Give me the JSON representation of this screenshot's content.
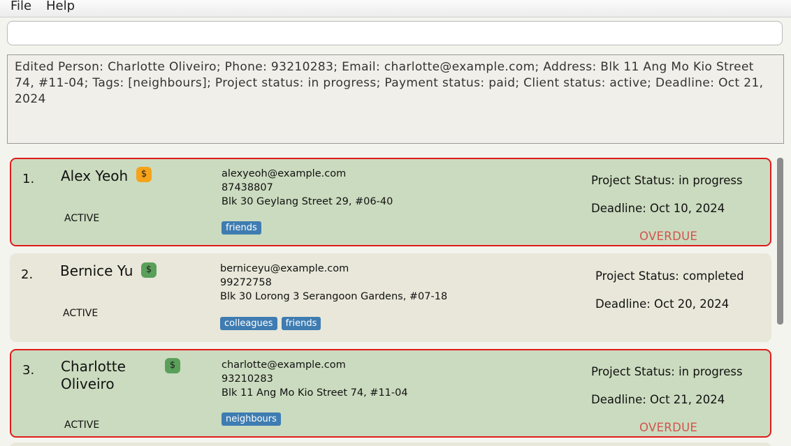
{
  "menu": [
    "File",
    "Help"
  ],
  "command_box": {
    "value": "",
    "placeholder": ""
  },
  "result": "Edited Person: Charlotte Oliveiro; Phone: 93210283; Email: charlotte@example.com; Address: Blk 11 Ang Mo Kio Street 74, #11-04; Tags: [neighbours]; Project status: in progress; Payment status: paid; Client status: active; Deadline: Oct 21, 2024",
  "colors": {
    "overdue_border": "#e01b1b",
    "overdue_card_bg": "#cbdbbf",
    "card_bg": "#e8e7d9",
    "tag_bg": "#3e7cb1",
    "pay_pending": "#f5a31a",
    "pay_paid": "#5aa05a",
    "overdue_text": "#d0544c"
  },
  "persons": [
    {
      "index": "1.",
      "name": "Alex Yeoh",
      "payment_icon": "dollar-icon",
      "payment_symbol": "$",
      "client_status": "ACTIVE",
      "email": "alexyeoh@example.com",
      "phone": "87438807",
      "address": "Blk 30 Geylang Street 29, #06-40",
      "tags": [
        "friends"
      ],
      "project_status": "Project Status: in progress",
      "deadline": "Deadline: Oct 10, 2024",
      "overdue": "OVERDUE"
    },
    {
      "index": "2.",
      "name": "Bernice Yu",
      "payment_icon": "dollar-icon",
      "payment_symbol": "$",
      "client_status": "ACTIVE",
      "email": "berniceyu@example.com",
      "phone": "99272758",
      "address": "Blk 30 Lorong 3 Serangoon Gardens, #07-18",
      "tags": [
        "colleagues",
        "friends"
      ],
      "project_status": "Project Status: completed",
      "deadline": "Deadline: Oct 20, 2024",
      "overdue": ""
    },
    {
      "index": "3.",
      "name": "Charlotte Oliveiro",
      "name_lines": [
        "Charlotte",
        "Oliveiro"
      ],
      "payment_icon": "dollar-icon",
      "payment_symbol": "$",
      "client_status": "ACTIVE",
      "email": "charlotte@example.com",
      "phone": "93210283",
      "address": "Blk 11 Ang Mo Kio Street 74, #11-04",
      "tags": [
        "neighbours"
      ],
      "project_status": "Project Status: in progress",
      "deadline": "Deadline: Oct 21, 2024",
      "overdue": "OVERDUE"
    }
  ]
}
